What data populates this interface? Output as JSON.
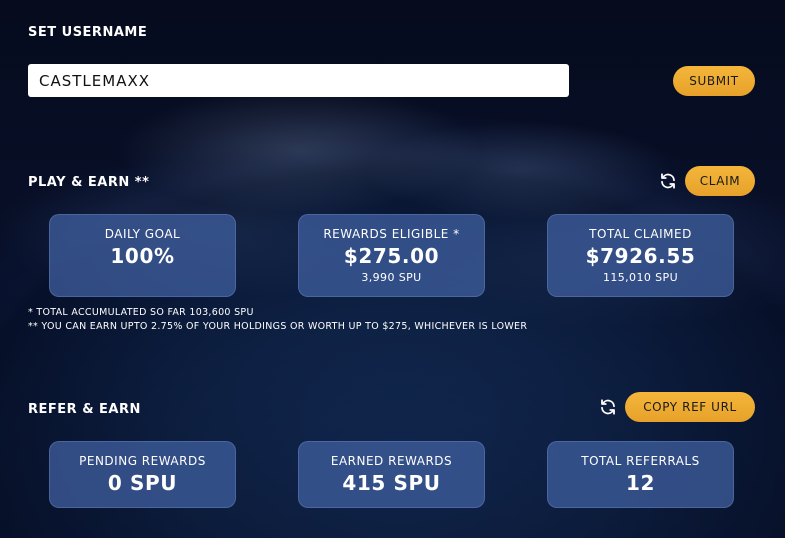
{
  "username_section": {
    "title": "SET USERNAME",
    "input_value": "CASTLEMAXX",
    "submit_label": "SUBMIT"
  },
  "play_section": {
    "title": "PLAY & EARN **",
    "claim_label": "CLAIM",
    "cards": {
      "daily_goal": {
        "label": "DAILY GOAL",
        "value": "100%"
      },
      "rewards_eligible": {
        "label": "REWARDS ELIGIBLE *",
        "value": "$275.00",
        "sub": "3,990 SPU"
      },
      "total_claimed": {
        "label": "TOTAL CLAIMED",
        "value": "$7926.55",
        "sub": "115,010 SPU"
      }
    },
    "footnotes": [
      "* TOTAL ACCUMULATED SO FAR 103,600 SPU",
      "** YOU CAN EARN UPTO 2.75% OF YOUR HOLDINGS OR WORTH UP TO $275, WHICHEVER IS LOWER"
    ]
  },
  "refer_section": {
    "title": "REFER & EARN",
    "copy_label": "COPY REF URL",
    "cards": {
      "pending_rewards": {
        "label": "PENDING REWARDS",
        "value": "0 SPU"
      },
      "earned_rewards": {
        "label": "EARNED REWARDS",
        "value": "415 SPU"
      },
      "total_referrals": {
        "label": "TOTAL REFERRALS",
        "value": "12"
      }
    }
  },
  "icons": {
    "refresh": "refresh-icon"
  },
  "colors": {
    "accent_button": "#f0b034",
    "card_background": "#3e5c9b",
    "page_background": "#060b1d"
  }
}
